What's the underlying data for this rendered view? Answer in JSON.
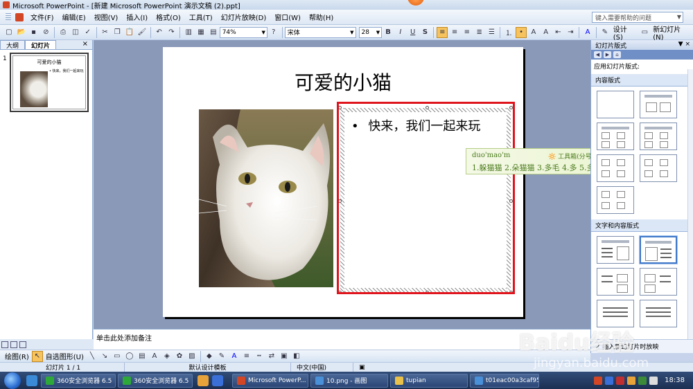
{
  "window": {
    "title": "Microsoft PowerPoint - [新建 Microsoft PowerPoint 演示文稿 (2).ppt]"
  },
  "menu": {
    "items": [
      "文件(F)",
      "编辑(E)",
      "视图(V)",
      "插入(I)",
      "格式(O)",
      "工具(T)",
      "幻灯片放映(D)",
      "窗口(W)",
      "帮助(H)"
    ],
    "help_placeholder": "键入需要帮助的问题"
  },
  "toolbar": {
    "zoom": "74%",
    "font_name": "宋体",
    "font_size": "28",
    "bold": "B",
    "italic": "I",
    "underline": "U",
    "shadow": "S",
    "design_label": "设计(S)",
    "new_slide_label": "新幻灯片(N)"
  },
  "left_panel": {
    "tabs": [
      "大纲",
      "幻灯片"
    ],
    "active_tab": "幻灯片",
    "slide_number": "1",
    "thumb_title": "可爱的小猫",
    "thumb_text": "• 快来，我们一起来玩"
  },
  "slide": {
    "title": "可爱的小猫",
    "bullet": "•",
    "content": "快来，我们一起来玩"
  },
  "ime": {
    "pinyin": "duo'mao'm",
    "tool_label": "工具箱(分号)",
    "candidates": "1.躲猫猫 2.朵猫猫 3.多毛 4.多 5.多吗"
  },
  "notes": {
    "placeholder": "单击此处添加备注"
  },
  "task_pane": {
    "title": "幻灯片版式",
    "subtitle": "应用幻灯片版式:",
    "section_content": "内容版式",
    "section_text_content": "文字和内容版式",
    "footer": "✓ 插入新幻灯片时放映"
  },
  "drawbar": {
    "draw_label": "绘图(R)",
    "autoshape_label": "自选图形(U)"
  },
  "status": {
    "slide": "幻灯片 1 / 1",
    "template": "默认设计模板",
    "language": "中文(中国)"
  },
  "taskbar": {
    "items": [
      {
        "label": "360安全浏览器 6.5",
        "color": "#2fa83a"
      },
      {
        "label": "360安全浏览器 6.5",
        "color": "#2fa83a"
      },
      {
        "label": "Microsoft PowerP...",
        "color": "#d24625"
      },
      {
        "label": "10.png - 画图",
        "color": "#4a90d9"
      },
      {
        "label": "tupian",
        "color": "#e8c04a"
      },
      {
        "label": "t01eac00a3caf95e...",
        "color": "#4a90d9"
      }
    ],
    "clock": "18:38"
  },
  "watermark": {
    "brand": "Baidu经验",
    "url": "jingyan.baidu.com"
  }
}
